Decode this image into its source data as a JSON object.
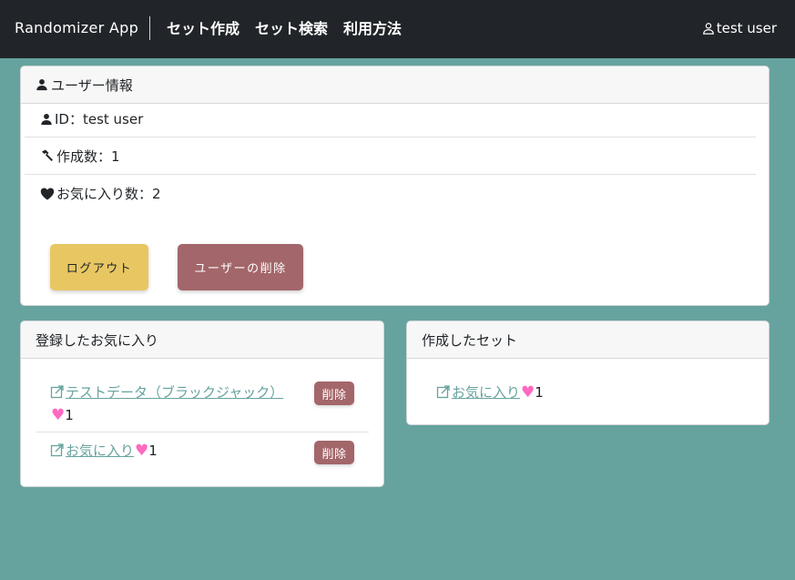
{
  "navbar": {
    "brand": "Randomizer App",
    "links": [
      "セット作成",
      "セット検索",
      "利用方法"
    ],
    "user": "test user"
  },
  "user_card": {
    "header": "ユーザー情報",
    "id_text": "ID：test user",
    "created_text": "作成数：1",
    "favorites_text": "お気に入り数：2",
    "logout_label": "ログアウト",
    "delete_user_label": "ユーザーの削除"
  },
  "favorites_card": {
    "header": "登録したお気に入り",
    "items": [
      {
        "title": "テストデータ（ブラックジャック）",
        "heart": "♥",
        "count": "1",
        "delete_label": "削除"
      },
      {
        "title": "お気に入り",
        "heart": "♥",
        "count": "1",
        "delete_label": "削除"
      }
    ]
  },
  "sets_card": {
    "header": "作成したセット",
    "items": [
      {
        "title": "お気に入り",
        "heart": "♥",
        "count": "1"
      }
    ]
  },
  "colors": {
    "background": "#66a39e",
    "navbar": "#212529",
    "logout": "#e8c763",
    "danger": "#a3666a",
    "heart": "#ff69c0",
    "link": "#66a39e"
  }
}
